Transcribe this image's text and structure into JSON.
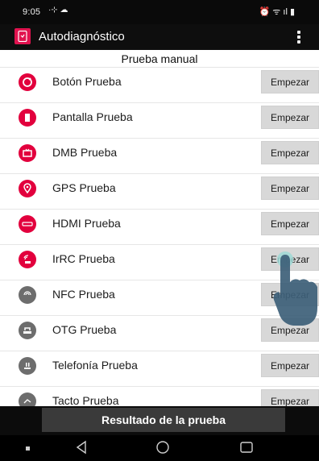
{
  "status_bar": {
    "time": "9:05",
    "left_icons": "·⊹ ☁",
    "right_icons": "⏰ ᯤ ıl ▮"
  },
  "app_bar": {
    "title": "Autodiagnóstico",
    "icons": {
      "app": "phone-diagnostic-icon",
      "menu": "overflow-menu-icon"
    },
    "accent_color": "#e1134f"
  },
  "section": {
    "title": "Prueba manual"
  },
  "tests": [
    {
      "label": "Botón Prueba",
      "button": "Empezar",
      "icon": "power-button-icon",
      "icon_color": "red"
    },
    {
      "label": "Pantalla Prueba",
      "button": "Empezar",
      "icon": "screen-icon",
      "icon_color": "red"
    },
    {
      "label": "DMB Prueba",
      "button": "Empezar",
      "icon": "tv-icon",
      "icon_color": "red"
    },
    {
      "label": "GPS Prueba",
      "button": "Empezar",
      "icon": "location-pin-icon",
      "icon_color": "red"
    },
    {
      "label": "HDMI Prueba",
      "button": "Empezar",
      "icon": "hdmi-icon",
      "icon_color": "red"
    },
    {
      "label": "IrRC Prueba",
      "button": "Empezar",
      "icon": "infrared-remote-icon",
      "icon_color": "red"
    },
    {
      "label": "NFC Prueba",
      "button": "Empezar",
      "icon": "nfc-icon",
      "icon_color": "gray"
    },
    {
      "label": "OTG Prueba",
      "button": "Empezar",
      "icon": "usb-otg-icon",
      "icon_color": "gray"
    },
    {
      "label": "Telefonía Prueba",
      "button": "Empezar",
      "icon": "sim-card-icon",
      "icon_color": "gray"
    },
    {
      "label": "Tacto Prueba",
      "button": "Empezar",
      "icon": "touch-icon",
      "icon_color": "gray"
    }
  ],
  "footer": {
    "result_button": "Resultado de la prueba"
  },
  "nav_bar": {
    "icons": [
      "recent-apps-dot-icon",
      "back-icon",
      "home-icon",
      "overview-icon"
    ]
  }
}
